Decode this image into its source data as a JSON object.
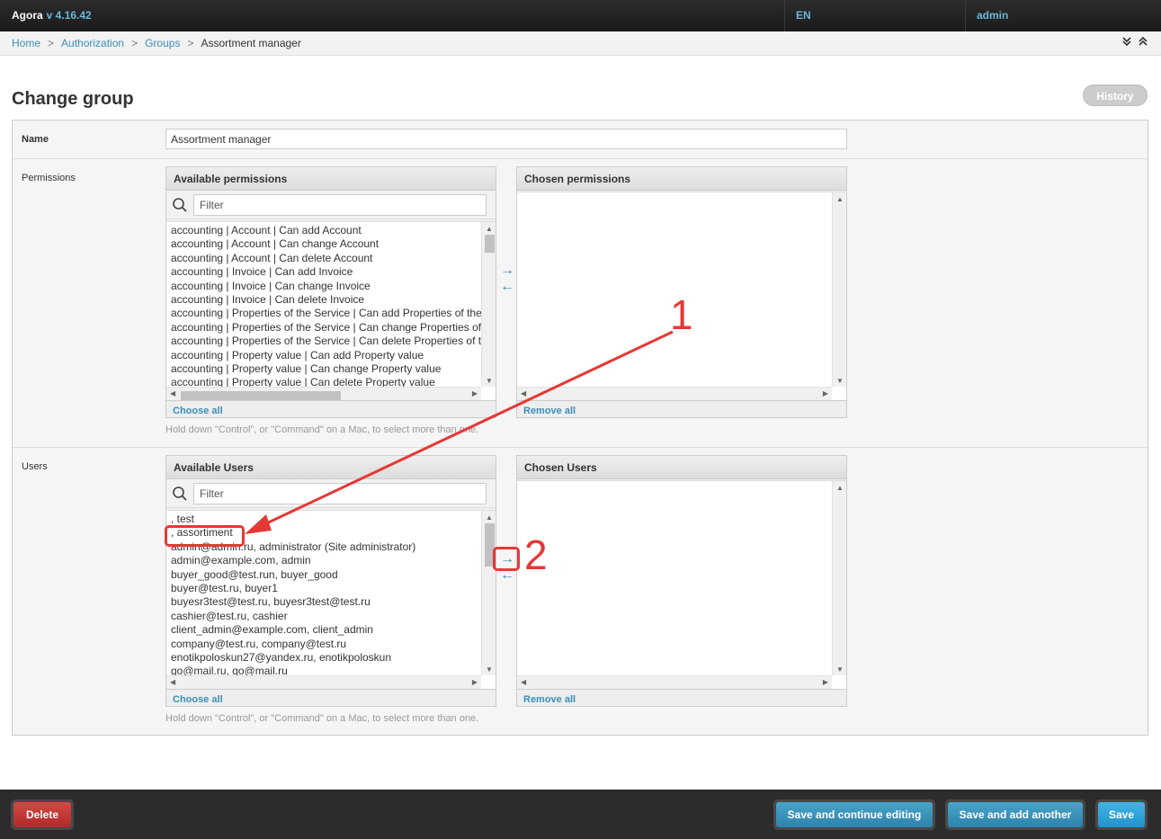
{
  "app": {
    "name": "Agora",
    "version": "v 4.16.42",
    "language": "EN",
    "user": "admin"
  },
  "breadcrumbs": [
    {
      "label": "Home"
    },
    {
      "label": "Authorization"
    },
    {
      "label": "Groups"
    },
    {
      "label": "Assortment manager"
    }
  ],
  "page": {
    "title": "Change group",
    "history_label": "History"
  },
  "form": {
    "name": {
      "label": "Name",
      "value": "Assortment manager"
    },
    "permissions": {
      "label": "Permissions",
      "available_title": "Available permissions",
      "chosen_title": "Chosen permissions",
      "filter_placeholder": "Filter",
      "choose_all": "Choose all",
      "remove_all": "Remove all",
      "items": [
        "accounting | Account | Can add Account",
        "accounting | Account | Can change Account",
        "accounting | Account | Can delete Account",
        "accounting | Invoice | Can add Invoice",
        "accounting | Invoice | Can change Invoice",
        "accounting | Invoice | Can delete Invoice",
        "accounting | Properties of the Service | Can add Properties of the Service",
        "accounting | Properties of the Service | Can change Properties of the Service",
        "accounting | Properties of the Service | Can delete Properties of the Service",
        "accounting | Property value | Can add Property value",
        "accounting | Property value | Can change Property value",
        "accounting | Property value | Can delete Property value"
      ],
      "help": "Hold down \"Control\", or \"Command\" on a Mac, to select more than one."
    },
    "users": {
      "label": "Users",
      "available_title": "Available Users",
      "chosen_title": "Chosen Users",
      "filter_placeholder": "Filter",
      "choose_all": "Choose all",
      "remove_all": "Remove all",
      "items": [
        ", test",
        ", assortiment",
        "admin@admin.ru, administrator (Site administrator)",
        "admin@example.com, admin",
        "buyer_good@test.run, buyer_good",
        "buyer@test.ru, buyer1",
        "buyesr3test@test.ru, buyesr3test@test.ru",
        "cashier@test.ru, cashier",
        "client_admin@example.com, client_admin",
        "company@test.ru, company@test.ru",
        "enotikpoloskun27@yandex.ru, enotikpoloskun",
        "go@mail.ru, go@mail.ru"
      ],
      "help": "Hold down \"Control\", or \"Command\" on a Mac, to select more than one."
    }
  },
  "annotations": {
    "step1": "1",
    "step2": "2",
    "color": "#e53935"
  },
  "footer": {
    "delete": "Delete",
    "save_continue": "Save and continue editing",
    "save_add": "Save and add another",
    "save": "Save"
  }
}
